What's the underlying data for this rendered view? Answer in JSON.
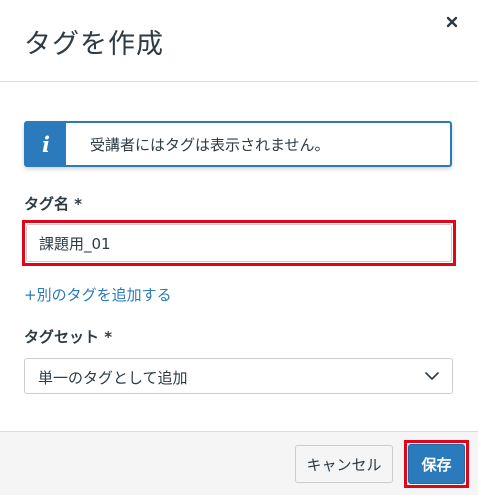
{
  "dialog": {
    "title": "タグを作成"
  },
  "info": {
    "icon": "i",
    "message": "受講者にはタグは表示されません。"
  },
  "tag_name": {
    "label": "タグ名",
    "required_mark": "*",
    "value": "課題用_01"
  },
  "add_tag_link": "+別のタグを追加する",
  "tag_set": {
    "label": "タグセット",
    "required_mark": "*",
    "selected": "単一のタグとして追加"
  },
  "footer": {
    "cancel_label": "キャンセル",
    "save_label": "保存"
  },
  "colors": {
    "accent": "#2b7abc",
    "highlight": "#e0061a",
    "text": "#2d3b45"
  }
}
